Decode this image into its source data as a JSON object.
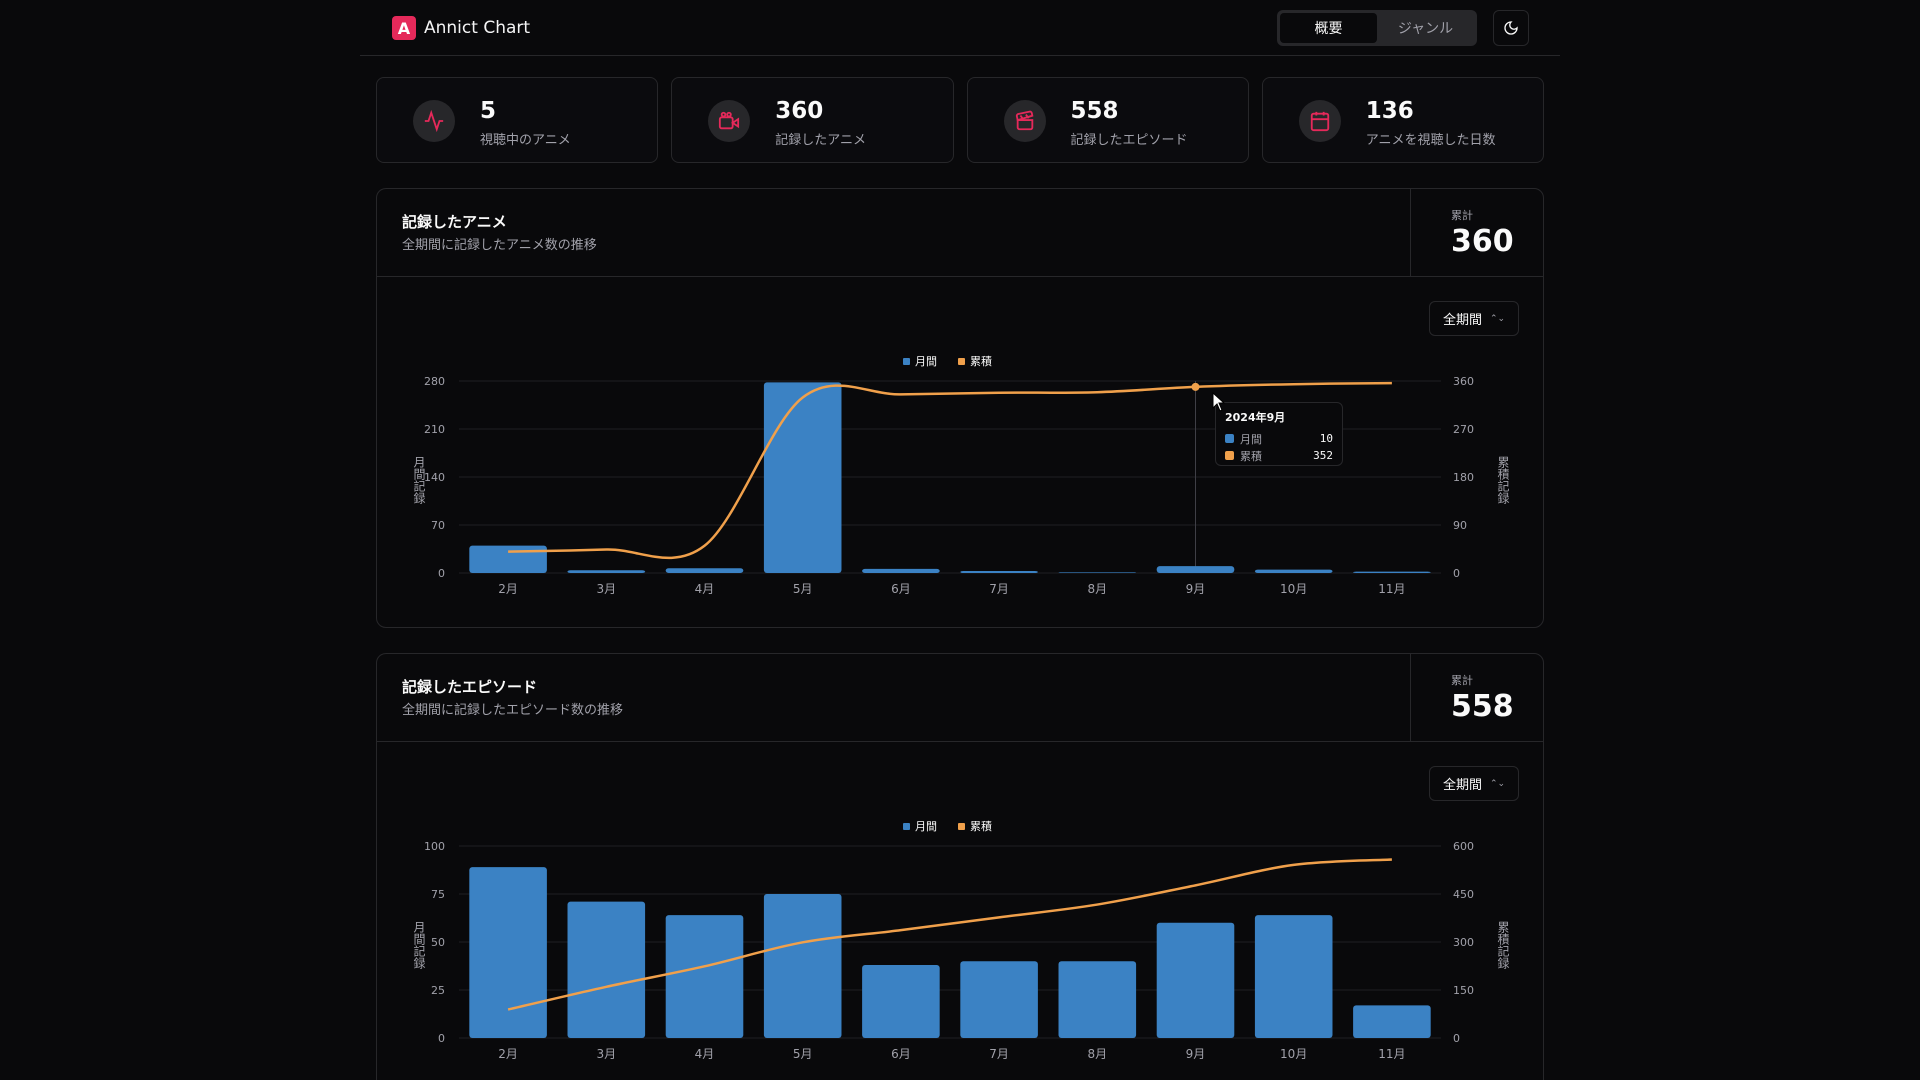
{
  "app": {
    "title": "Annict Chart"
  },
  "nav": {
    "tabs": [
      {
        "label": "概要",
        "active": true
      },
      {
        "label": "ジャンル",
        "active": false
      }
    ]
  },
  "theme": {
    "icon": "moon-icon"
  },
  "stats": [
    {
      "value": "5",
      "label": "視聴中のアニメ",
      "icon": "activity-icon"
    },
    {
      "value": "360",
      "label": "記録したアニメ",
      "icon": "video-icon"
    },
    {
      "value": "558",
      "label": "記録したエピソード",
      "icon": "clapperboard-icon"
    },
    {
      "value": "136",
      "label": "アニメを視聴した日数",
      "icon": "calendar-icon"
    }
  ],
  "colors": {
    "accent": "#e5295a",
    "bar": "#3b82c4",
    "line": "#f0a04b"
  },
  "cards": [
    {
      "title": "記録したアニメ",
      "desc": "全期間に記録したアニメ数の推移",
      "total_label": "累計",
      "total_value": "360",
      "period": "全期間",
      "tooltip": {
        "title": "2024年9月",
        "monthly_label": "月間",
        "monthly_value": "10",
        "cumulative_label": "累積",
        "cumulative_value": "352"
      }
    },
    {
      "title": "記録したエピソード",
      "desc": "全期間に記録したエピソード数の推移",
      "total_label": "累計",
      "total_value": "558",
      "period": "全期間"
    }
  ],
  "chart_data": [
    {
      "type": "bar",
      "categories": [
        "2月",
        "3月",
        "4月",
        "5月",
        "6月",
        "7月",
        "8月",
        "9月",
        "10月",
        "11月"
      ],
      "series": [
        {
          "name": "月間",
          "values": [
            40,
            4,
            7,
            278,
            6,
            3,
            1,
            10,
            5,
            2
          ],
          "axis": "left"
        },
        {
          "name": "累積",
          "values": [
            40,
            44,
            51,
            329,
            335,
            338,
            339,
            349,
            354,
            356
          ],
          "axis": "right",
          "type": "line"
        }
      ],
      "ylabel": "月間記録",
      "y2label": "累積記録",
      "yticks": [
        0,
        70,
        140,
        210,
        280
      ],
      "y2ticks": [
        0,
        90,
        180,
        270,
        360
      ],
      "ylim": [
        0,
        280
      ],
      "y2lim": [
        0,
        360
      ],
      "legend": "top-center",
      "grid": true
    },
    {
      "type": "bar",
      "categories": [
        "2月",
        "3月",
        "4月",
        "5月",
        "6月",
        "7月",
        "8月",
        "9月",
        "10月",
        "11月"
      ],
      "series": [
        {
          "name": "月間",
          "values": [
            89,
            71,
            64,
            75,
            38,
            40,
            40,
            60,
            64,
            17
          ],
          "axis": "left"
        },
        {
          "name": "累積",
          "values": [
            89,
            160,
            224,
            299,
            337,
            377,
            417,
            477,
            541,
            558
          ],
          "axis": "right",
          "type": "line"
        }
      ],
      "ylabel": "月間記録",
      "y2label": "累積記録",
      "yticks": [
        0,
        25,
        50,
        75,
        100
      ],
      "y2ticks": [
        0,
        150,
        300,
        450,
        600
      ],
      "ylim": [
        0,
        100
      ],
      "y2lim": [
        0,
        600
      ],
      "legend": "top-center",
      "grid": true
    }
  ]
}
